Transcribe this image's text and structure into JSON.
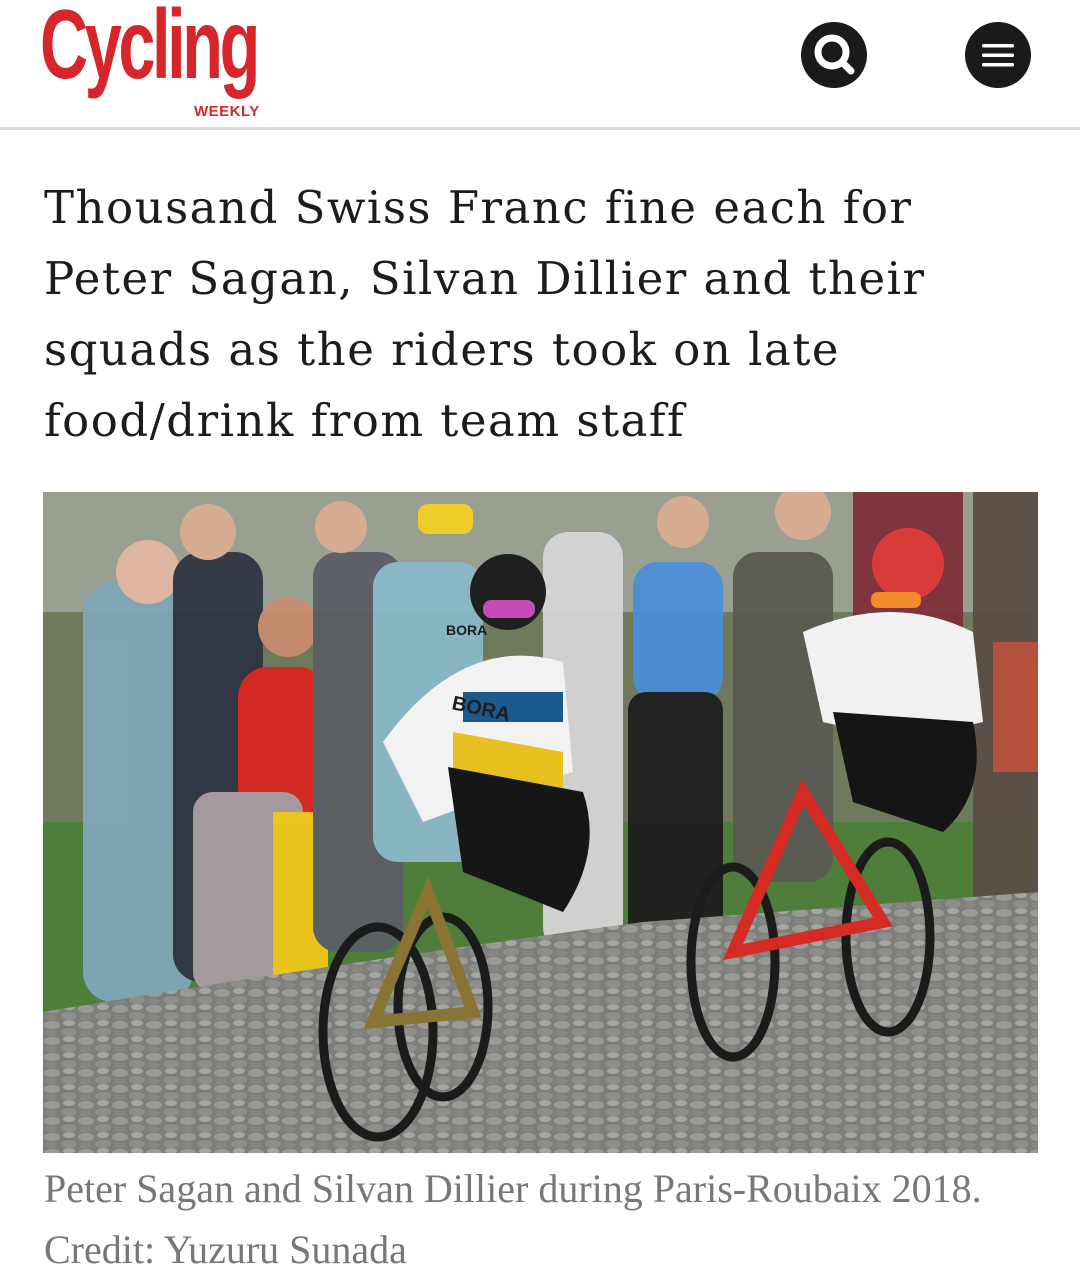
{
  "header": {
    "logo": {
      "main": "Cycling",
      "sub": "WEEKLY"
    },
    "search_icon": "search-icon",
    "menu_icon": "hamburger-menu-icon"
  },
  "article": {
    "headline": "Thousand Swiss Franc fine each for Peter Sagan, Silvan Dillier and their squads as the riders took on late food/drink from team staff",
    "image": {
      "jersey_text_left": "BORA",
      "jersey_text_chest": "BORA"
    },
    "caption": "Peter Sagan and Silvan Dillier during Paris-Roubaix 2018. Credit: Yuzuru Sunada"
  },
  "colors": {
    "brand_red": "#d7262b",
    "icon_bg": "#1a1a1a",
    "caption_gray": "#777777"
  }
}
